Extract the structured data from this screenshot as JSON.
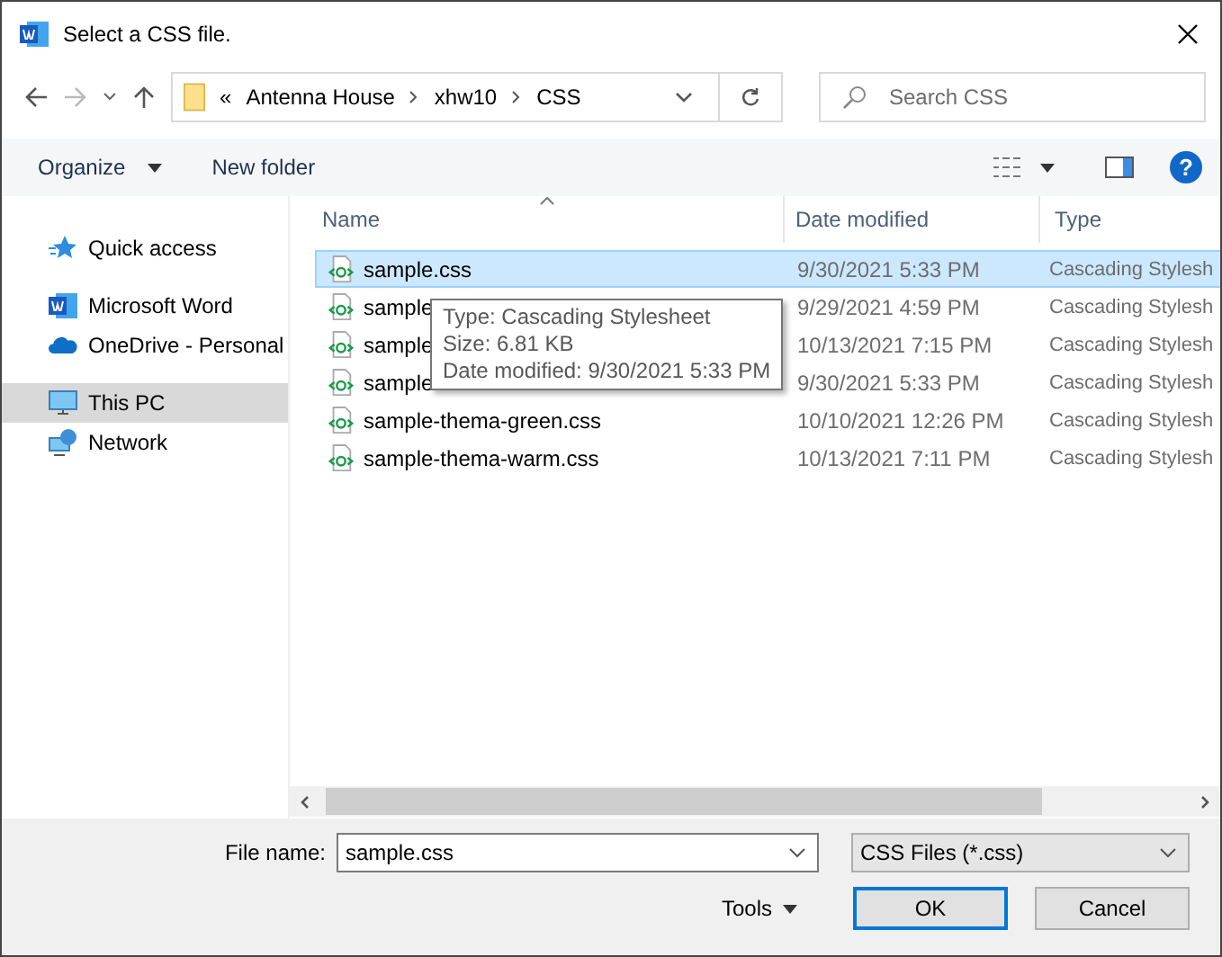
{
  "window": {
    "title": "Select a CSS file."
  },
  "breadcrumb": {
    "overflow": "«",
    "segments": [
      "Antenna House",
      "xhw10",
      "CSS"
    ]
  },
  "search": {
    "placeholder": "Search CSS"
  },
  "toolbar": {
    "organize": "Organize",
    "new_folder": "New folder",
    "help": "?"
  },
  "sidebar": {
    "items": [
      {
        "label": "Quick access",
        "kind": "star",
        "selected": false
      },
      {
        "label": "Microsoft Word",
        "kind": "word",
        "selected": false
      },
      {
        "label": "OneDrive - Personal",
        "kind": "cloud",
        "selected": false
      },
      {
        "label": "This PC",
        "kind": "pc",
        "selected": true
      },
      {
        "label": "Network",
        "kind": "network",
        "selected": false
      }
    ]
  },
  "table": {
    "columns": [
      "Name",
      "Date modified",
      "Type"
    ],
    "rows": [
      {
        "name": "sample.css",
        "date": "9/30/2021 5:33 PM",
        "type": "Cascading Stylesh",
        "selected": true
      },
      {
        "name": "sample",
        "date": "9/29/2021 4:59 PM",
        "type": "Cascading Stylesh",
        "selected": false
      },
      {
        "name": "sample",
        "date": "10/13/2021 7:15 PM",
        "type": "Cascading Stylesh",
        "selected": false
      },
      {
        "name": "sample",
        "date": "9/30/2021 5:33 PM",
        "type": "Cascading Stylesh",
        "selected": false
      },
      {
        "name": "sample-thema-green.css",
        "date": "10/10/2021 12:26 PM",
        "type": "Cascading Stylesh",
        "selected": false
      },
      {
        "name": "sample-thema-warm.css",
        "date": "10/13/2021 7:11 PM",
        "type": "Cascading Stylesh",
        "selected": false
      }
    ]
  },
  "tooltip": {
    "lines": [
      "Type: Cascading Stylesheet",
      "Size: 6.81 KB",
      "Date modified: 9/30/2021 5:33 PM"
    ]
  },
  "footer": {
    "file_name_label": "File name:",
    "file_name": "sample.css",
    "filter": "CSS Files (*.css)",
    "tools": "Tools",
    "ok": "OK",
    "cancel": "Cancel"
  }
}
